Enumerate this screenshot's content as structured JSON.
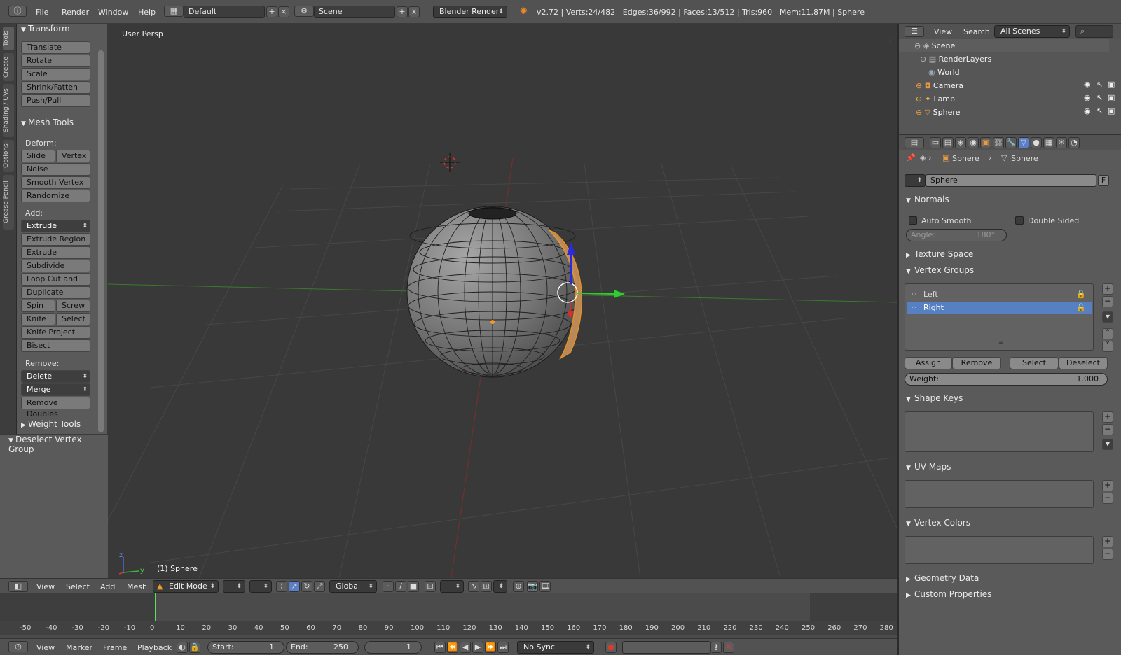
{
  "topbar": {
    "menus": [
      "File",
      "Render",
      "Window",
      "Help"
    ],
    "layout": "Default",
    "scene": "Scene",
    "engine": "Blender Render",
    "stats": "v2.72 | Verts:24/482 | Edges:36/992 | Faces:13/512 | Tris:960 | Mem:11.87M | Sphere"
  },
  "tabs": [
    "Tools",
    "Create",
    "Shading / UVs",
    "Options",
    "Grease Pencil"
  ],
  "shelf": {
    "transform": {
      "title": "Transform",
      "buttons": [
        "Translate",
        "Rotate",
        "Scale",
        "Shrink/Fatten",
        "Push/Pull"
      ]
    },
    "mesh_tools": {
      "title": "Mesh Tools",
      "deform_label": "Deform:",
      "slide": "Slide Ed",
      "vertex": "Vertex",
      "noise": "Noise",
      "smooth": "Smooth Vertex",
      "randomize": "Randomize",
      "add_label": "Add:",
      "extrude": "Extrude",
      "extrude_region": "Extrude Region",
      "extrude_individual": "Extrude Individual",
      "subdivide": "Subdivide",
      "loopcut": "Loop Cut and Slide",
      "duplicate": "Duplicate",
      "spin": "Spin",
      "screw": "Screw",
      "knife": "Knife",
      "select": "Select",
      "knife_project": "Knife Project",
      "bisect": "Bisect",
      "remove_label": "Remove:",
      "delete": "Delete",
      "merge": "Merge",
      "remove_doubles": "Remove Doubles"
    },
    "weight_tools": "Weight Tools",
    "operator": "Deselect Vertex Group"
  },
  "viewport": {
    "label": "User Persp",
    "object": "(1) Sphere",
    "axis_z": "z",
    "axis_y": "y"
  },
  "viewheader": {
    "menus": [
      "View",
      "Select",
      "Add",
      "Mesh"
    ],
    "mode": "Edit Mode",
    "orientation": "Global"
  },
  "timeline": {
    "ticks": [
      "-50",
      "-40",
      "-30",
      "-20",
      "-10",
      "0",
      "10",
      "20",
      "30",
      "40",
      "50",
      "60",
      "70",
      "80",
      "90",
      "100",
      "110",
      "120",
      "130",
      "140",
      "150",
      "160",
      "170",
      "180",
      "190",
      "200",
      "210",
      "220",
      "230",
      "240",
      "250",
      "260",
      "270",
      "280"
    ],
    "current_frame": "1"
  },
  "tlbar": {
    "menus": [
      "View",
      "Marker",
      "Frame",
      "Playback"
    ],
    "start_label": "Start:",
    "start": "1",
    "end_label": "End:",
    "end": "250",
    "frame": "1",
    "sync": "No Sync"
  },
  "outliner": {
    "menus": [
      "View",
      "Search"
    ],
    "filter": "All Scenes",
    "items": [
      "Scene",
      "RenderLayers",
      "World",
      "Camera",
      "Lamp",
      "Sphere"
    ]
  },
  "props": {
    "breadcrumb": [
      "Sphere",
      "Sphere"
    ],
    "datablock": "Sphere",
    "fake": "F",
    "normals": {
      "title": "Normals",
      "auto_smooth": "Auto Smooth",
      "double_sided": "Double Sided",
      "angle_label": "Angle:",
      "angle": "180°"
    },
    "texture_space": "Texture Space",
    "vertex_groups": {
      "title": "Vertex Groups",
      "items": [
        "Left",
        "Right"
      ],
      "assign": "Assign",
      "remove": "Remove",
      "select": "Select",
      "deselect": "Deselect",
      "weight_label": "Weight:",
      "weight": "1.000"
    },
    "shape_keys": "Shape Keys",
    "uv_maps": "UV Maps",
    "vertex_colors": "Vertex Colors",
    "geometry_data": "Geometry Data",
    "custom_properties": "Custom Properties"
  }
}
